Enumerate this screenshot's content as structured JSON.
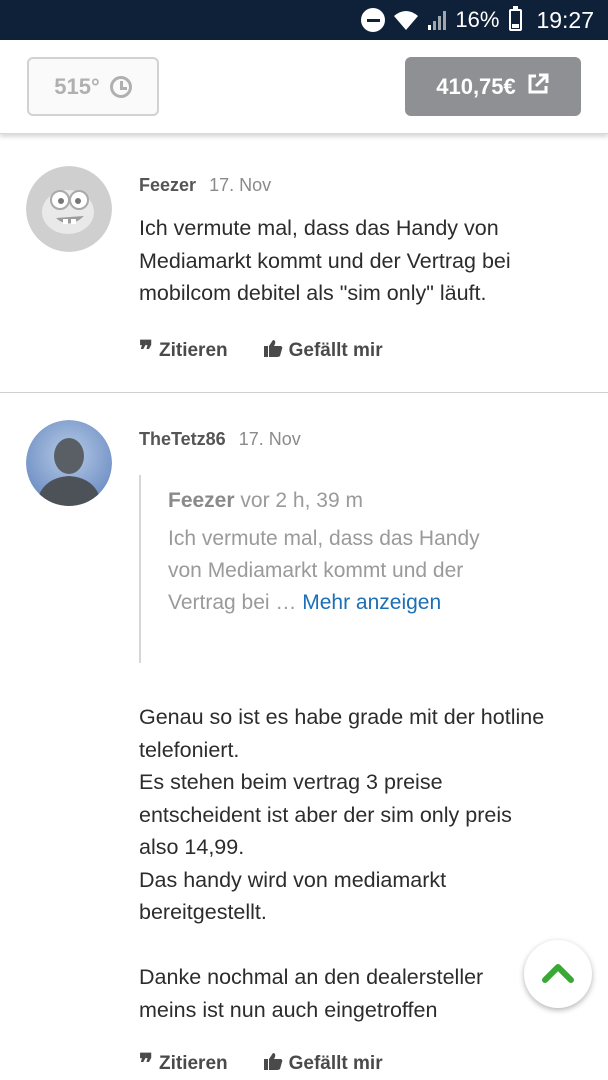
{
  "status_bar": {
    "battery_percent": "16%",
    "time": "19:27"
  },
  "deal": {
    "temperature": "515°",
    "price": "410,75€"
  },
  "comments": [
    {
      "author": "Feezer",
      "date": "17. Nov",
      "text_lines": [
        "Ich vermute mal, dass das Handy von",
        "Mediamarkt kommt und der Vertrag bei",
        "mobilcom debitel als \"sim only\" läuft."
      ],
      "actions": {
        "quote": "Zitieren",
        "like": "Gefällt mir"
      }
    },
    {
      "author": "TheTetz86",
      "date": "17. Nov",
      "quote": {
        "author": "Feezer",
        "time": "vor 2 h, 39 m",
        "lines": [
          "Ich vermute mal, dass das Handy",
          "von Mediamarkt kommt und der",
          "Vertrag bei …"
        ],
        "more_link": "Mehr anzeigen"
      },
      "text_lines": [
        "Genau so ist es habe grade mit der hotline",
        "telefoniert.",
        "Es stehen beim vertrag 3 preise",
        "entscheident ist aber der sim only preis",
        "also 14,99.",
        "Das handy wird von mediamarkt",
        "bereitgestellt.",
        "",
        "Danke nochmal an den dealersteller",
        "meins ist nun auch eingetroffen"
      ],
      "actions": {
        "quote": "Zitieren",
        "like": "Gefällt mir"
      }
    }
  ],
  "colors": {
    "status_bar_bg": "#0f2139",
    "price_button_bg": "#8e9093",
    "link_blue": "#1c6fb6",
    "fab_arrow_green": "#3aa835"
  }
}
